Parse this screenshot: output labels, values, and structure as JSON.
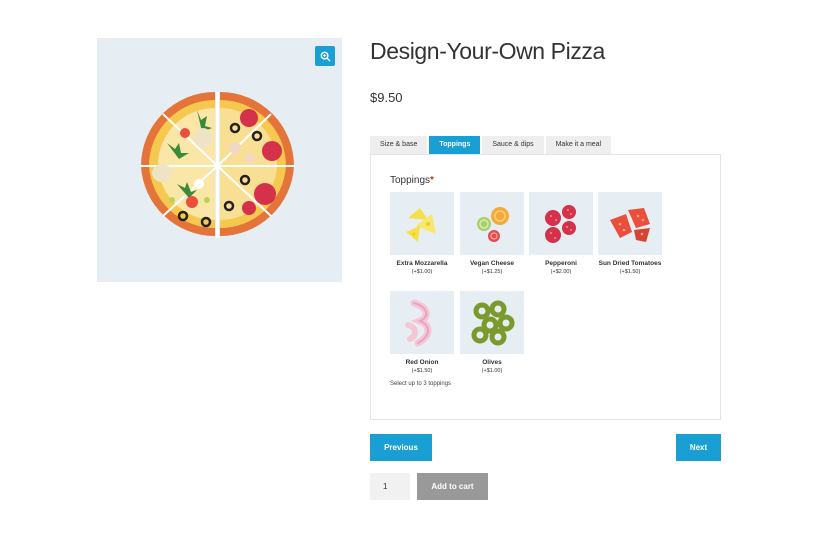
{
  "product": {
    "title": "Design-Your-Own Pizza",
    "price": "$9.50"
  },
  "gallery": {
    "zoom_icon": "zoom-in-icon",
    "image_icon": "pizza-image"
  },
  "tabs": [
    {
      "label": "Size & base",
      "active": false
    },
    {
      "label": "Toppings",
      "active": true
    },
    {
      "label": "Sauce & dips",
      "active": false
    },
    {
      "label": "Make it a meal",
      "active": false
    }
  ],
  "toppings": {
    "heading": "Toppings",
    "required_mark": "*",
    "options": [
      {
        "name": "Extra Mozzarella",
        "price": "(+$1.00)",
        "icon": "cheese-icon"
      },
      {
        "name": "Vegan Cheese",
        "price": "(+$1.25)",
        "icon": "vegan-cheese-icon"
      },
      {
        "name": "Pepperoni",
        "price": "(+$2.00)",
        "icon": "pepperoni-icon"
      },
      {
        "name": "Sun Dried Tomatoes",
        "price": "(+$1.50)",
        "icon": "tomato-icon"
      },
      {
        "name": "Red Onion",
        "price": "(+$1.50)",
        "icon": "onion-icon"
      },
      {
        "name": "Olives",
        "price": "(+$1.00)",
        "icon": "olives-icon"
      }
    ],
    "hint": "Select up to 3 toppings"
  },
  "nav": {
    "previous": "Previous",
    "next": "Next"
  },
  "cart": {
    "quantity": "1",
    "add_label": "Add to cart"
  },
  "colors": {
    "accent": "#1a9fd4",
    "disabled": "#999999",
    "thumb_bg": "#e7eef3"
  }
}
